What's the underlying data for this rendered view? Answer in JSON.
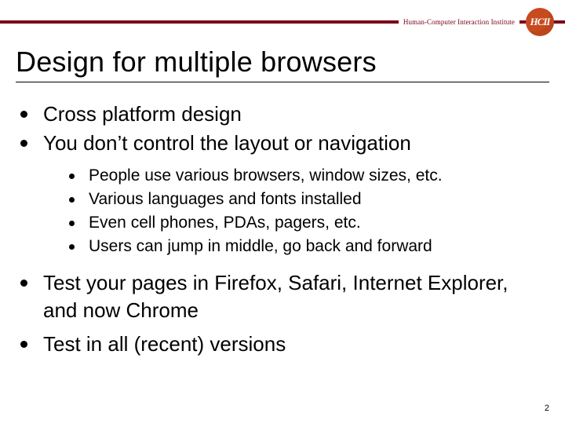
{
  "brand": {
    "institute": "Human-Computer Interaction Institute",
    "logo_monogram": "HCII",
    "stripe_color": "#7a0019",
    "logo_color": "#c84a1f"
  },
  "title": "Design for multiple browsers",
  "bullets": {
    "b1": "Cross platform design",
    "b2": "You don’t control the layout or navigation",
    "b2_sub": {
      "s1": "People use various browsers, window sizes, etc.",
      "s2": "Various languages and fonts installed",
      "s3": "Even cell phones, PDAs, pagers, etc.",
      "s4": "Users can jump in middle, go back and forward"
    },
    "b3": "Test your pages in Firefox, Safari, Internet Explorer, and now Chrome",
    "b4": "Test in all (recent) versions"
  },
  "page_number": "2"
}
